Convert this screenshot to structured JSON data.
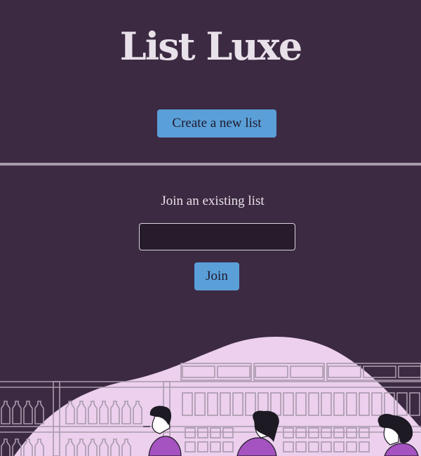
{
  "app": {
    "title": "List Luxe"
  },
  "create": {
    "button_label": "Create a new list"
  },
  "join": {
    "heading": "Join an existing list",
    "input_value": "",
    "input_placeholder": "",
    "button_label": "Join"
  },
  "colors": {
    "background": "#3c2a42",
    "accent_button": "#5b9fd8",
    "title_text": "#e8e1ea",
    "illustration_blob": "#ecd0ee",
    "shopper_shirt": "#a553c0"
  },
  "illustration": {
    "icon": "grocery-shoppers-illustration"
  }
}
